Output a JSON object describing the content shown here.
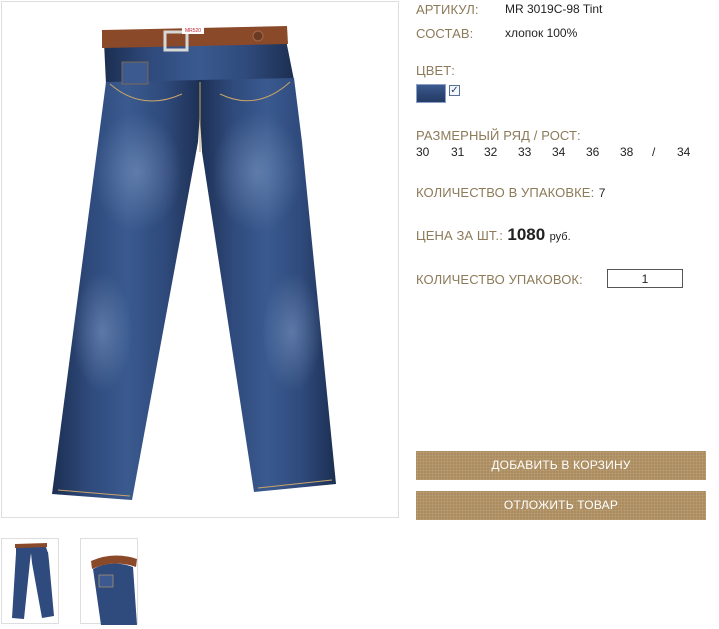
{
  "product": {
    "article_label": "АРТИКУЛ:",
    "article_value": "MR 3019C-98 Tint",
    "composition_label": "СОСТАВ:",
    "composition_value": "хлопок 100%",
    "color_label": "ЦВЕТ:",
    "color_checkbox_mark": "✓",
    "size_label": "РАЗМЕРНЫЙ РЯД / РОСТ:",
    "sizes": [
      "30",
      "31",
      "32",
      "33",
      "34",
      "36",
      "38",
      "/",
      "34"
    ],
    "pack_qty_label": "КОЛИЧЕСТВО В УПАКОВКЕ:",
    "pack_qty_value": "7",
    "price_label": "ЦЕНА ЗА ШТ.:",
    "price_value": "1080",
    "price_currency": "руб.",
    "packs_label": "КОЛИЧЕСТВО УПАКОВОК:",
    "packs_value": "1",
    "logo_text": "MR520"
  },
  "actions": {
    "add_to_cart": "ДОБАВИТЬ В КОРЗИНУ",
    "defer": "ОТЛОЖИТЬ ТОВАР"
  },
  "colors": {
    "label": "#8c7a59",
    "button": "#a9895a",
    "denim": "#2d4675",
    "belt": "#8a4a2a"
  }
}
